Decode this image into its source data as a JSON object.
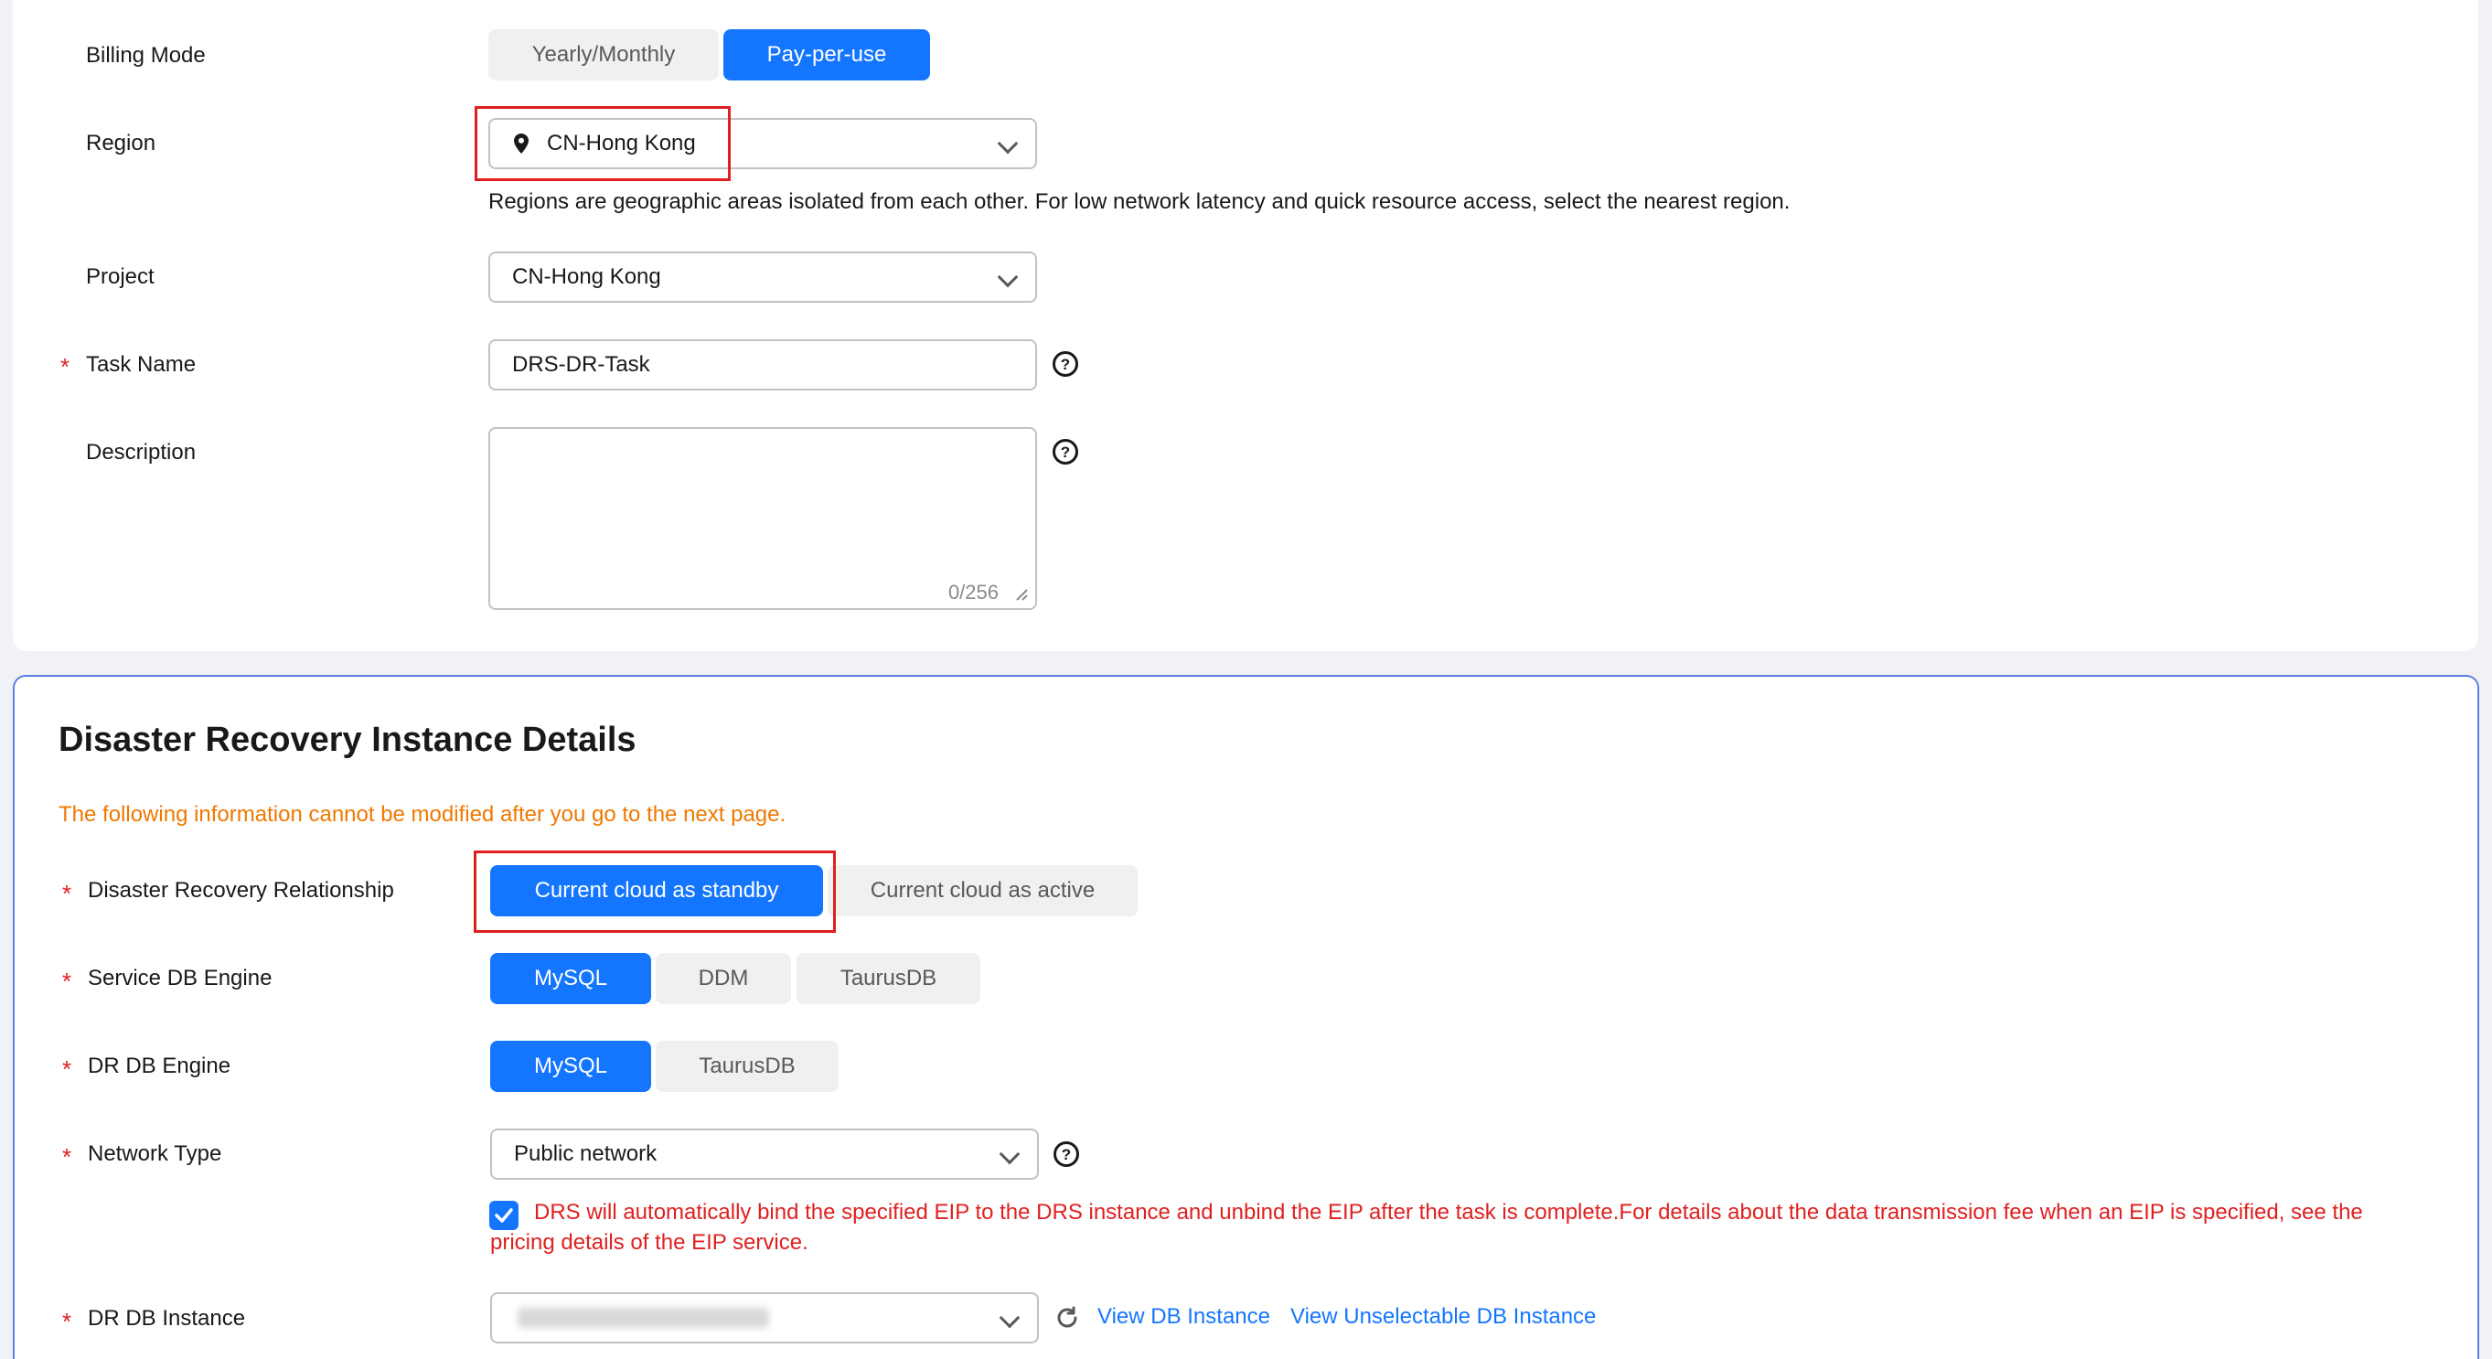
{
  "basic": {
    "billing_mode": {
      "label": "Billing Mode",
      "options": [
        "Yearly/Monthly",
        "Pay-per-use"
      ],
      "selected": "Pay-per-use"
    },
    "region": {
      "label": "Region",
      "value": "CN-Hong Kong",
      "hint": "Regions are geographic areas isolated from each other. For low network latency and quick resource access, select the nearest region."
    },
    "project": {
      "label": "Project",
      "value": "CN-Hong Kong"
    },
    "task_name": {
      "label": "Task Name",
      "value": "DRS-DR-Task",
      "required_mark": "*"
    },
    "description": {
      "label": "Description",
      "value": "",
      "counter": "0/256"
    },
    "help_glyph": "?"
  },
  "dr": {
    "title": "Disaster Recovery Instance Details",
    "warning": "The following information cannot be modified after you go to the next page.",
    "relationship": {
      "label": "Disaster Recovery Relationship",
      "options": [
        "Current cloud as standby",
        "Current cloud as active"
      ],
      "selected": "Current cloud as standby"
    },
    "service_engine": {
      "label": "Service DB Engine",
      "options": [
        "MySQL",
        "DDM",
        "TaurusDB"
      ],
      "selected": "MySQL"
    },
    "dr_engine": {
      "label": "DR DB Engine",
      "options": [
        "MySQL",
        "TaurusDB"
      ],
      "selected": "MySQL"
    },
    "network_type": {
      "label": "Network Type",
      "value": "Public network",
      "checkbox_checked": true,
      "notice_line1": "DRS will automatically bind the specified EIP to the DRS instance and unbind the EIP after the task is complete.For details about the data transmission fee when an EIP is specified, see the",
      "notice_line2": "pricing details of the EIP service."
    },
    "dr_instance": {
      "label": "DR DB Instance",
      "view_link": "View DB Instance",
      "unselectable_link": "View Unselectable DB Instance"
    },
    "required_mark": "*"
  },
  "colors": {
    "primary": "#1476ff",
    "warning": "#f07800",
    "error": "#e02020",
    "highlight_box": "#e02020"
  }
}
